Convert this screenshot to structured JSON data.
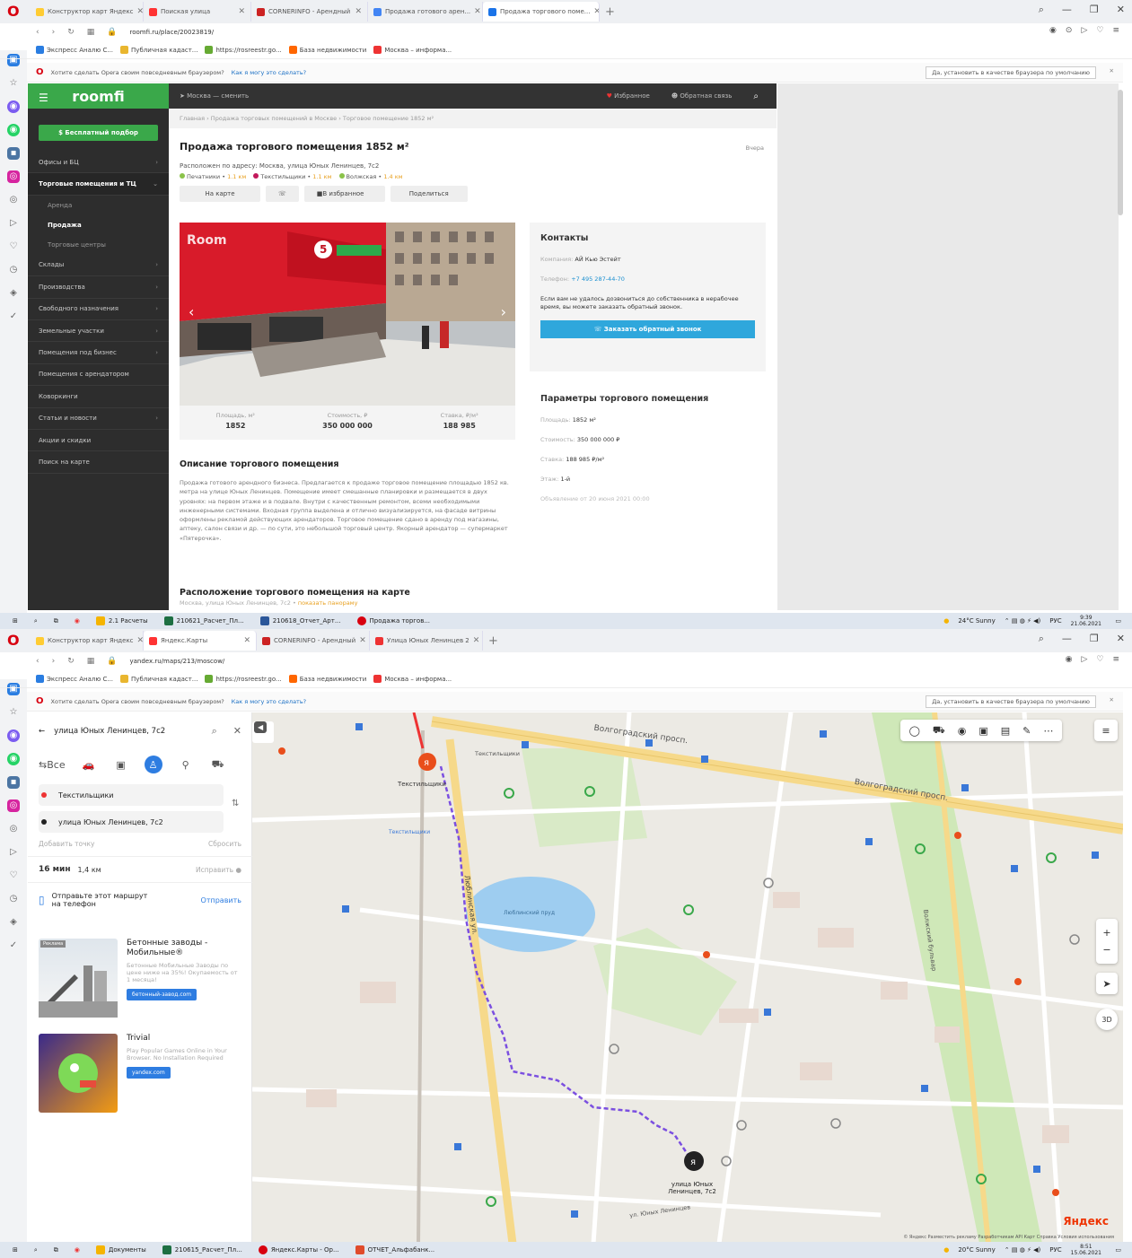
{
  "screen1": {
    "tabs": [
      "Конструктор карт Яндекс",
      "Поиская улица",
      "CORNERINFO - Арендный",
      "Продажа готового арен...",
      "Продажа торгового поме..."
    ],
    "url": "roomfi.ru/place/20023819/",
    "bookmarks": [
      "Экспресс Аналю С...",
      "Публичная кадаст...",
      "https://rosreestr.go...",
      "База недвижимости",
      "Москва – информа..."
    ],
    "notice": "Хотите сделать Opera своим повседневным браузером?",
    "notice_link": "Как я могу это сделать?",
    "notice_btn": "Да, установить в качестве браузера по умолчанию",
    "site": {
      "logo": "roomfi",
      "city": "Москва — сменить",
      "fav": "Избранное",
      "feedback": "Обратная связь",
      "free_btn": "Бесплатный подбор",
      "menu": [
        {
          "label": "Офисы и БЦ",
          "arrow": true
        },
        {
          "label": "Торговые помещения и ТЦ",
          "arrow": true,
          "open": true
        },
        {
          "label": "Аренда",
          "sub": true
        },
        {
          "label": "Продажа",
          "sub": true,
          "current": true
        },
        {
          "label": "Торговые центры",
          "sub": true
        },
        {
          "label": "Склады",
          "arrow": true
        },
        {
          "label": "Производства",
          "arrow": true
        },
        {
          "label": "Свободного назначения",
          "arrow": true
        },
        {
          "label": "Земельные участки",
          "arrow": true
        },
        {
          "label": "Помещения под бизнес",
          "arrow": true
        },
        {
          "label": "Помещения с арендатором",
          "arrow": false
        },
        {
          "label": "Коворкинги",
          "arrow": false
        },
        {
          "label": "Статьи и новости",
          "arrow": true
        },
        {
          "label": "Акции и скидки",
          "arrow": false
        },
        {
          "label": "Поиск на карте",
          "arrow": false
        }
      ],
      "breadcrumbs": "Главная  ›  Продажа торговых помещений в Москве  ›  Торговое помещение 1852 м²",
      "title": "Продажа торгового помещения 1852 м²",
      "date": "Вчера",
      "address": "Расположен по адресу: Москва, улица Юных Ленинцев, 7с2",
      "metro": [
        {
          "name": "Печатники",
          "dist": "1.1 км",
          "color": "#8bc34a"
        },
        {
          "name": "Текстильщики",
          "dist": "1.1 км",
          "color": "#c2185b"
        },
        {
          "name": "Волжская",
          "dist": "1.4 км",
          "color": "#8bc34a"
        }
      ],
      "actions": [
        "На карте",
        "☏",
        "В избранное",
        "Поделиться"
      ],
      "stats": [
        {
          "label": "Площадь, м²",
          "value": "1852"
        },
        {
          "label": "Стоимость, ₽",
          "value": "350 000 000"
        },
        {
          "label": "Ставка, ₽/м²",
          "value": "188 985"
        }
      ],
      "contacts": {
        "title": "Контакты",
        "company_label": "Компания:",
        "company": "АЙ Кью Эстейт",
        "phone_label": "Телефон:",
        "phone": "+7 495 287-44-70",
        "message": "Если вам не удалось дозвониться до собственника в нерабочее время, вы можете заказать обратный звонок.",
        "button": "Заказать обратный звонок"
      },
      "params": {
        "title": "Параметры торгового помещения",
        "area_label": "Площадь:",
        "area": "1852 м²",
        "price_label": "Стоимость:",
        "price": "350 000 000 ₽",
        "rate_label": "Ставка:",
        "rate": "188 985 ₽/м²",
        "floor_label": "Этаж:",
        "floor": "1-й",
        "posted": "Объявление от 20 июня 2021 00:00"
      },
      "desc_title": "Описание торгового помещения",
      "desc": "Продажа готового арендного бизнеса. Предлагается к продаже торговое помещение площадью 1852 кв. метра на улице Юных Ленинцев. Помещение имеет смешанные планировки и размещается в двух уровнях: на первом этаже и в подвале. Внутри с качественным ремонтом, всеми необходимыми инженерными системами. Входная группа выделена и отлично визуализируется, на фасаде витрины оформлены рекламой действующих арендаторов. Торговое помещение сдано в аренду под магазины, аптеку, салон связи и др. — по сути, это небольшой торговый центр. Якорный арендатор — супермаркет «Пятерочка».",
      "map_title": "Расположение торгового помещения на карте",
      "map_sub": "Москва, улица Юных Ленинцев, 7с2",
      "map_link": "показать панораму"
    },
    "taskbar": [
      "2.1 Расчеты",
      "210621_Расчет_Пл...",
      "210618_Отчет_Арт...",
      "Продажа торгов..."
    ],
    "tray": {
      "weather": "24°C Sunny",
      "lang": "РУС",
      "time": "9:39",
      "date": "21.06.2021"
    }
  },
  "screen2": {
    "tabs": [
      "Конструктор карт Яндекс",
      "Яндекс.Карты",
      "CORNERINFO - Арендный",
      "Улица Юных Ленинцев 2"
    ],
    "url": "yandex.ru/maps/213/moscow/",
    "route": {
      "query": "улица Юных Ленинцев, 7с2",
      "mode_all": "Все",
      "from": "Текстильщики",
      "to": "улица Юных Ленинцев, 7с2",
      "add_point": "Добавить точку",
      "reset": "Сбросить",
      "time": "16 мин",
      "distance": "1,4 км",
      "fix": "Исправить",
      "send_text": "Отправьте этот маршрут на телефон",
      "send_btn": "Отправить"
    },
    "ads": [
      {
        "badge": "Реклама",
        "title": "Бетонные заводы - Мобильные®",
        "text": "Бетонные Мобильные Заводы по цене ниже на 35%! Окупаемость от 1 месяца!",
        "btn": "бетонный-завод.com"
      },
      {
        "title": "Trivial",
        "text": "Play Popular Games Online in Your Browser. No Installation Required",
        "btn": "yandex.com"
      }
    ],
    "map_labels": {
      "street_top": "Волгоградский просп.",
      "street_top2": "Волгоградский просп.",
      "metro_top": "Текстильщики",
      "metro_top2": "Текстильщики",
      "metro_mid": "Текстильщики",
      "street_lub": "Люблинская ул.",
      "pond": "Люблинский пруд",
      "dest": "улица Юных Ленинцев, 7с2",
      "street_bot": "ул. Юных Ленинцев",
      "street_v": "Волжский бульвар",
      "brand": "Яндекс",
      "copy": "© Яндекс  Разместить рекламу  Разработчикам  API Карт  Справка  Условия использования"
    },
    "taskbar": [
      "Документы",
      "210615_Расчет_Пл...",
      "Яндекс.Карты - Ор...",
      "ОТЧЕТ_Альфабанк..."
    ],
    "tray": {
      "weather": "20°C Sunny",
      "lang": "РУС",
      "time": "8:51",
      "date": "15.06.2021"
    }
  }
}
